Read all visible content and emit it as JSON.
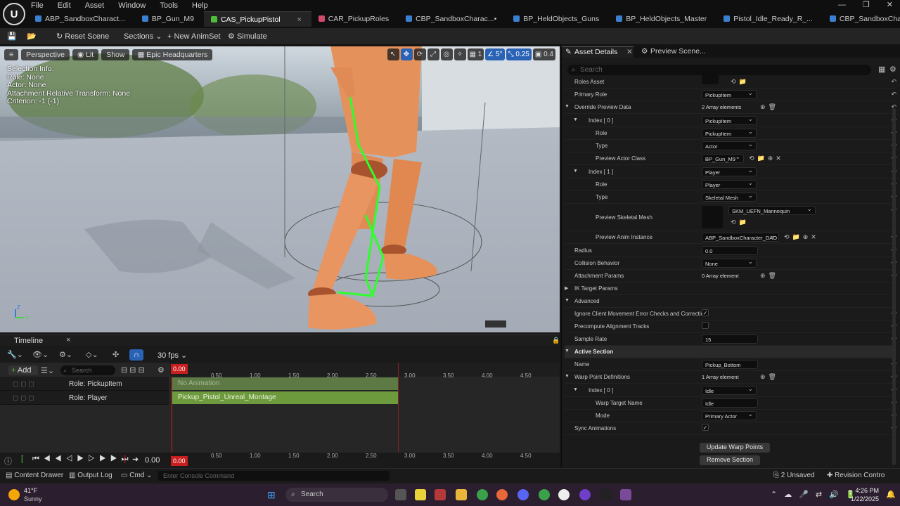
{
  "app": {
    "logo": "U"
  },
  "menu": [
    "File",
    "Edit",
    "Asset",
    "Window",
    "Tools",
    "Help"
  ],
  "tabs": [
    {
      "label": "ABP_SandboxCharact...",
      "color": "#3b7fd1"
    },
    {
      "label": "BP_Gun_M9",
      "color": "#3b7fd1"
    },
    {
      "label": "CAS_PickupPistol",
      "color": "#4fbd3a",
      "active": true,
      "close": "×"
    },
    {
      "label": "CAR_PickupRoles",
      "color": "#d24a6b"
    },
    {
      "label": "CBP_SandboxCharac...•",
      "color": "#3b7fd1"
    },
    {
      "label": "BP_HeldObjects_Guns",
      "color": "#3b7fd1"
    },
    {
      "label": "BP_HeldObjects_Master",
      "color": "#3b7fd1"
    },
    {
      "label": "Pistol_Idle_Ready_R_...",
      "color": "#3b7fd1"
    },
    {
      "label": "CBP_SandboxCharacter",
      "color": "#3b7fd1"
    }
  ],
  "toolbar": {
    "reset_scene": "Reset Scene",
    "sections": "Sections",
    "new_animset": "New AnimSet",
    "simulate": "Simulate"
  },
  "viewport": {
    "perspective": "Perspective",
    "lit": "Lit",
    "show": "Show",
    "location": "Epic Headquarters",
    "grid_value": "1",
    "angle_value": "5°",
    "scale_value": "0.25",
    "camera_value": "0.4",
    "selection_info": [
      "Selection Info:",
      "Role: None",
      "Actor: None",
      "Attachment Relative Transform: None",
      "Criterion: -1 (-1)"
    ],
    "axis_x": "X",
    "axis_y": "Y",
    "axis_z": "Z"
  },
  "timeline": {
    "tab": "Timeline",
    "tab_close": "×",
    "fps": "30 fps",
    "add": "Add",
    "search_placeholder": "Search",
    "current_time": "0.00",
    "ticks": [
      "0.50",
      "1.00",
      "1.50",
      "2.00",
      "2.50",
      "3.00",
      "3.50",
      "4.00",
      "4.50"
    ],
    "tracks": [
      {
        "label": "Role: PickupItem",
        "segment": "No Animation"
      },
      {
        "label": "Role: Player",
        "segment": "Pickup_Pistol_Unreal_Montage"
      }
    ],
    "transport_time": "0.00",
    "bottom_time": "0.00"
  },
  "details": {
    "tab_asset": "Asset Details",
    "tab_preview": "Preview Scene...",
    "search_placeholder": "Search",
    "rows": [
      {
        "label": "Roles Asset",
        "indent": 0,
        "kind": "asset"
      },
      {
        "label": "Primary Role",
        "indent": 0,
        "kind": "dd",
        "value": "PickupItem"
      },
      {
        "label": "Override Preview Data",
        "indent": 0,
        "kind": "array",
        "value": "2 Array elements",
        "arrow": "▼"
      },
      {
        "label": "Index [ 0 ]",
        "indent": 1,
        "kind": "dd",
        "value": "PickupItem",
        "arrow": "▼"
      },
      {
        "label": "Role",
        "indent": 2,
        "kind": "dd",
        "value": "PickupItem"
      },
      {
        "label": "Type",
        "indent": 2,
        "kind": "dd",
        "value": "Actor"
      },
      {
        "label": "Preview Actor Class",
        "indent": 2,
        "kind": "ddicons",
        "value": "BP_Gun_M9"
      },
      {
        "label": "Index [ 1 ]",
        "indent": 1,
        "kind": "dd",
        "value": "Player",
        "arrow": "▼"
      },
      {
        "label": "Role",
        "indent": 2,
        "kind": "dd",
        "value": "Player"
      },
      {
        "label": "Type",
        "indent": 2,
        "kind": "dd",
        "value": "Skeletal Mesh"
      },
      {
        "label": "Preview Skeletal Mesh",
        "indent": 2,
        "kind": "mesh",
        "value": "SKM_UEFN_Mannequin"
      },
      {
        "label": "Preview Anim Instance",
        "indent": 2,
        "kind": "ddicons",
        "value": "ABP_SandboxCharacter_DAO"
      },
      {
        "label": "Radius",
        "indent": 0,
        "kind": "txt",
        "value": "0.0"
      },
      {
        "label": "Collision Behavior",
        "indent": 0,
        "kind": "dd",
        "value": "None"
      },
      {
        "label": "Attachment Params",
        "indent": 0,
        "kind": "array",
        "value": "0 Array element"
      },
      {
        "label": "IK Target Params",
        "indent": 0,
        "kind": "head",
        "arrow": "▶"
      },
      {
        "label": "Advanced",
        "indent": 0,
        "kind": "head",
        "arrow": "▼"
      },
      {
        "label": "Ignore Client Movement Error Checks and Correction",
        "indent": 0,
        "kind": "chk",
        "value": "✓"
      },
      {
        "label": "Precompute Alignment Tracks",
        "indent": 0,
        "kind": "chk",
        "value": ""
      },
      {
        "label": "Sample Rate",
        "indent": 0,
        "kind": "txt",
        "value": "15"
      },
      {
        "label": "Active Section",
        "indent": 0,
        "kind": "section",
        "arrow": "▼"
      },
      {
        "label": "Name",
        "indent": 0,
        "kind": "txt",
        "value": "Pickup_Bottom"
      },
      {
        "label": "Warp Point Definitions",
        "indent": 0,
        "kind": "array",
        "value": "1 Array element",
        "arrow": "▼"
      },
      {
        "label": "Index [ 0 ]",
        "indent": 1,
        "kind": "dd",
        "value": "Idle",
        "arrow": "▼"
      },
      {
        "label": "Warp Target Name",
        "indent": 2,
        "kind": "txt",
        "value": "Idle"
      },
      {
        "label": "Mode",
        "indent": 2,
        "kind": "dd",
        "value": "Primary Actor"
      },
      {
        "label": "Sync Animations",
        "indent": 0,
        "kind": "chk",
        "value": "✓"
      }
    ],
    "btn_update": "Update Warp Points",
    "btn_remove": "Remove Section"
  },
  "statusbar": {
    "content_drawer": "Content Drawer",
    "output_log": "Output Log",
    "cmd": "Cmd",
    "console_placeholder": "Enter Console Command",
    "unsaved": "2 Unsaved",
    "revision": "Revision Contro"
  },
  "taskbar": {
    "temp": "41°F",
    "weather": "Sunny",
    "search": "Search",
    "time": "4:26 PM",
    "date": "1/22/2025"
  }
}
